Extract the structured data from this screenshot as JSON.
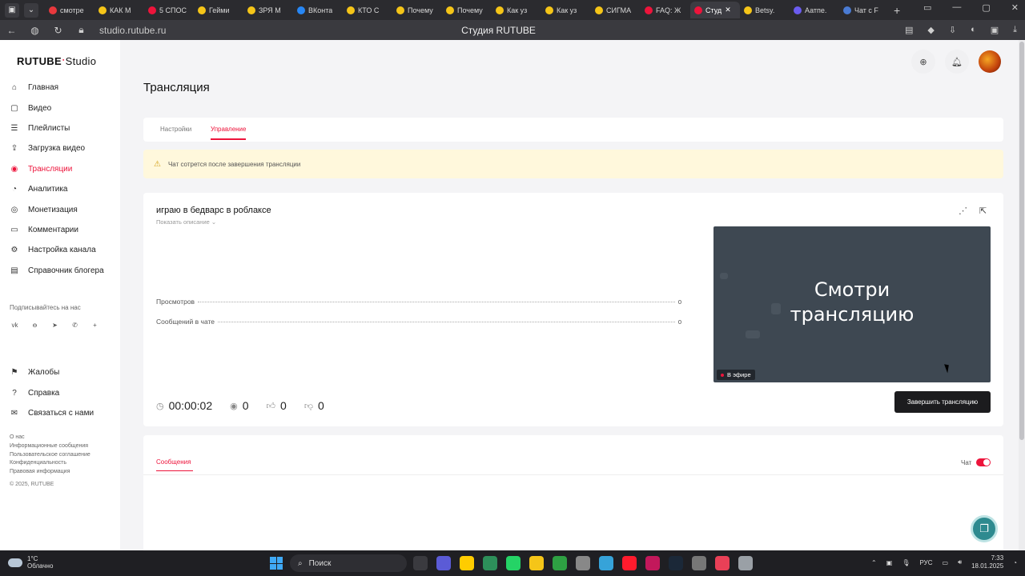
{
  "browser": {
    "tabs": [
      {
        "label": "смотре",
        "color": "#e8383d"
      },
      {
        "label": "КАК М",
        "color": "#f5c518"
      },
      {
        "label": "5 СПОС",
        "color": "#ed143b"
      },
      {
        "label": "Гейми",
        "color": "#f5c518"
      },
      {
        "label": "ЗРЯ М",
        "color": "#f5c518"
      },
      {
        "label": "ВКонта",
        "color": "#2787f5"
      },
      {
        "label": "КТО С",
        "color": "#f5c518"
      },
      {
        "label": "Почему",
        "color": "#f5c518"
      },
      {
        "label": "Почему",
        "color": "#f5c518"
      },
      {
        "label": "Как уз",
        "color": "#f5c518"
      },
      {
        "label": "Как уз",
        "color": "#f5c518"
      },
      {
        "label": "СИГМА",
        "color": "#f5c518"
      },
      {
        "label": "FAQ: Ж",
        "color": "#ed143b"
      },
      {
        "label": "Студ",
        "color": "#ed143b",
        "active": true
      },
      {
        "label": "Betsy.",
        "color": "#f5c518"
      },
      {
        "label": "Аатпе.",
        "color": "#6b5cf0"
      },
      {
        "label": "Чат с F",
        "color": "#4a7bd4"
      }
    ],
    "url": "studio.rutube.ru",
    "page_title": "Студия RUTUBE"
  },
  "sidebar": {
    "logo_main": "RUTUBE",
    "logo_sub": "Studio",
    "items": [
      {
        "label": "Главная",
        "icon": "home-icon",
        "glyph": "⌂"
      },
      {
        "label": "Видео",
        "icon": "video-icon",
        "glyph": "▢"
      },
      {
        "label": "Плейлисты",
        "icon": "playlist-icon",
        "glyph": "☰"
      },
      {
        "label": "Загрузка видео",
        "icon": "upload-icon",
        "glyph": "⇪"
      },
      {
        "label": "Трансляции",
        "icon": "broadcast-icon",
        "glyph": "◉",
        "active": true
      },
      {
        "label": "Аналитика",
        "icon": "analytics-icon",
        "glyph": "◔"
      },
      {
        "label": "Монетизация",
        "icon": "money-icon",
        "glyph": "◎"
      },
      {
        "label": "Комментарии",
        "icon": "comments-icon",
        "glyph": "▭"
      },
      {
        "label": "Настройка канала",
        "icon": "gear-icon",
        "glyph": "⚙"
      },
      {
        "label": "Справочник блогера",
        "icon": "book-icon",
        "glyph": "▤"
      }
    ],
    "subscribe_label": "Подписывайтесь на нас",
    "socials": [
      {
        "name": "vk-icon",
        "glyph": "vk"
      },
      {
        "name": "ok-icon",
        "glyph": "ꙫ"
      },
      {
        "name": "telegram-icon",
        "glyph": "➤"
      },
      {
        "name": "viber-icon",
        "glyph": "✆"
      },
      {
        "name": "more-icon",
        "glyph": "+"
      }
    ],
    "items2": [
      {
        "label": "Жалобы",
        "icon": "flag-icon",
        "glyph": "⚑"
      },
      {
        "label": "Справка",
        "icon": "help-icon",
        "glyph": "?"
      },
      {
        "label": "Связаться с нами",
        "icon": "mail-icon",
        "glyph": "✉"
      }
    ],
    "footer_links": [
      "О нас",
      "Информационные сообщения",
      "Пользовательское соглашение",
      "Конфиденциальность",
      "Правовая информация"
    ],
    "copyright": "© 2025, RUTUBE"
  },
  "page": {
    "title": "Трансляция",
    "tabs": [
      {
        "label": "Настройки"
      },
      {
        "label": "Управление",
        "active": true
      }
    ],
    "warning": "Чат сотрется после завершения трансляции",
    "stream": {
      "title": "играю в бедварс в роблаксе",
      "show_description": "Показать описание",
      "stats": [
        {
          "label": "Просмотров",
          "value": "0"
        },
        {
          "label": "Сообщений в чате",
          "value": "0"
        }
      ],
      "duration": "00:00:02",
      "viewers": "0",
      "likes": "0",
      "dislikes": "0",
      "preview_text_line1": "Смотри",
      "preview_text_line2": "трансляцию",
      "on_air": "В эфире",
      "end_button": "Завершить трансляцию"
    },
    "chat": {
      "messages_tab": "Сообщения",
      "chat_toggle_label": "Чат",
      "chat_enabled": true
    }
  },
  "taskbar": {
    "weather_temp": "1°C",
    "weather_desc": "Облачно",
    "search_label": "Поиск",
    "lang": "РУС",
    "time": "7:33",
    "date": "18.01.2025",
    "apps": [
      "#3a3a3f",
      "#5b5bd6",
      "#ffcc00",
      "#2d8f5a",
      "#25d366",
      "#f5c518",
      "#2ea043",
      "#888888",
      "#36a3d9",
      "#ff1b2d",
      "#c2185b",
      "#1b2838",
      "#777777",
      "#e94057",
      "#9aa0a6"
    ]
  }
}
